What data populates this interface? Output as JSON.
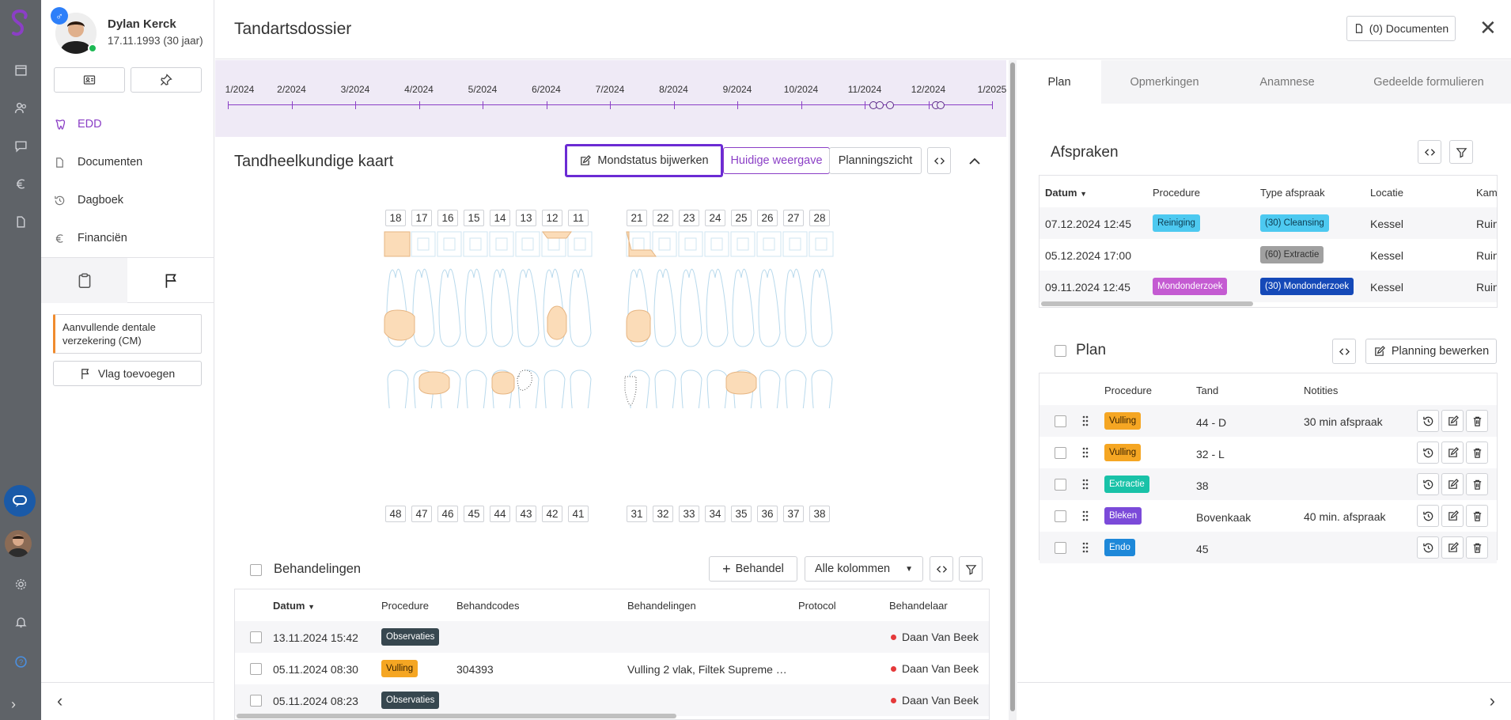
{
  "patient": {
    "name": "Dylan Kerck",
    "dob": "17.11.1993 (30 jaar)",
    "gender_symbol": "♂"
  },
  "sidebar": {
    "items": [
      {
        "label": "EDD",
        "icon": "tooth-icon",
        "active": true
      },
      {
        "label": "Documenten",
        "icon": "document-icon"
      },
      {
        "label": "Dagboek",
        "icon": "history-icon"
      },
      {
        "label": "Financiën",
        "icon": "euro-icon"
      }
    ],
    "flag_note": "Aanvullende dentale verzekering (CM)",
    "add_flag_label": "Vlag toevoegen"
  },
  "header": {
    "title": "Tandartsdossier",
    "documents_label": "(0) Documenten"
  },
  "timeline": {
    "months": [
      "1/2024",
      "2/2024",
      "3/2024",
      "4/2024",
      "5/2024",
      "6/2024",
      "7/2024",
      "8/2024",
      "9/2024",
      "10/2024",
      "11/2024",
      "12/2024",
      "1/2025"
    ]
  },
  "dental_chart": {
    "title": "Tandheelkundige kaart",
    "update_button": "Mondstatus bijwerken",
    "current_view": "Huidige weergave",
    "planning_view": "Planningszicht",
    "upper_right": [
      "18",
      "17",
      "16",
      "15",
      "14",
      "13",
      "12",
      "11"
    ],
    "upper_left": [
      "21",
      "22",
      "23",
      "24",
      "25",
      "26",
      "27",
      "28"
    ],
    "lower_right": [
      "48",
      "47",
      "46",
      "45",
      "44",
      "43",
      "42",
      "41"
    ],
    "lower_left": [
      "31",
      "32",
      "33",
      "34",
      "35",
      "36",
      "37",
      "38"
    ],
    "filling_color": "#fbdcb8",
    "outline_color": "#a9d2ea"
  },
  "treatments": {
    "title": "Behandelingen",
    "add_label": "Behandel",
    "columns_label": "Alle kolommen",
    "headers": [
      "Datum",
      "Procedure",
      "Behandcodes",
      "Behandelingen",
      "Protocol",
      "Behandelaar"
    ],
    "rows": [
      {
        "date": "13.11.2024 15:42",
        "procedure": "Observaties",
        "codes": "",
        "treatments": "",
        "protocol": "",
        "dentist": "Daan Van Beek",
        "color": "#37474f",
        "text_color": "#ffffff"
      },
      {
        "date": "05.11.2024 08:30",
        "procedure": "Vulling",
        "codes": "304393",
        "treatments": "Vulling 2 vlak, Filtek Supreme …",
        "protocol": "",
        "dentist": "Daan Van Beek",
        "color": "#f5a623",
        "text_color": "#3a2200"
      },
      {
        "date": "05.11.2024 08:23",
        "procedure": "Observaties",
        "codes": "",
        "treatments": "",
        "protocol": "",
        "dentist": "Daan Van Beek",
        "color": "#37474f",
        "text_color": "#ffffff"
      }
    ]
  },
  "right_tabs": [
    "Plan",
    "Opmerkingen",
    "Anamnese",
    "Gedeelde formulieren"
  ],
  "appointments": {
    "title": "Afspraken",
    "headers": [
      "Datum",
      "Procedure",
      "Type afspraak",
      "Locatie",
      "Kam"
    ],
    "rows": [
      {
        "date": "07.12.2024 12:45",
        "procedure": "Reiniging",
        "proc_color": "#4dc9f0",
        "type": "(30) Cleansing",
        "type_color": "#4dc9f0",
        "type_text": "#0d3b4f",
        "location": "Kessel",
        "room": "Ruin"
      },
      {
        "date": "05.12.2024 17:00",
        "procedure": "",
        "proc_color": "",
        "type": "(60) Extractie",
        "type_color": "#a0a0a0",
        "type_text": "#333333",
        "location": "Kessel",
        "room": "Ruin"
      },
      {
        "date": "09.11.2024 12:45",
        "procedure": "Mondonderzoek",
        "proc_color": "#c45bd2",
        "type": "(30) Mondonderzoek",
        "type_color": "#1549b8",
        "type_text": "#ffffff",
        "location": "Kessel",
        "room": "Ruin"
      }
    ]
  },
  "plan": {
    "title": "Plan",
    "edit_label": "Planning bewerken",
    "headers": [
      "Procedure",
      "Tand",
      "Notities"
    ],
    "rows": [
      {
        "procedure": "Vulling",
        "color": "#f5a623",
        "text_color": "#3a2200",
        "tooth": "44 - D",
        "notes": "30 min afspraak"
      },
      {
        "procedure": "Vulling",
        "color": "#f5a623",
        "text_color": "#3a2200",
        "tooth": "32 - L",
        "notes": ""
      },
      {
        "procedure": "Extractie",
        "color": "#19c2a8",
        "text_color": "#ffffff",
        "tooth": "38",
        "notes": ""
      },
      {
        "procedure": "Bleken",
        "color": "#7b4ad9",
        "text_color": "#ffffff",
        "tooth": "Bovenkaak",
        "notes": "40 min. afspraak"
      },
      {
        "procedure": "Endo",
        "color": "#1e88d9",
        "text_color": "#ffffff",
        "tooth": "45",
        "notes": ""
      }
    ]
  }
}
